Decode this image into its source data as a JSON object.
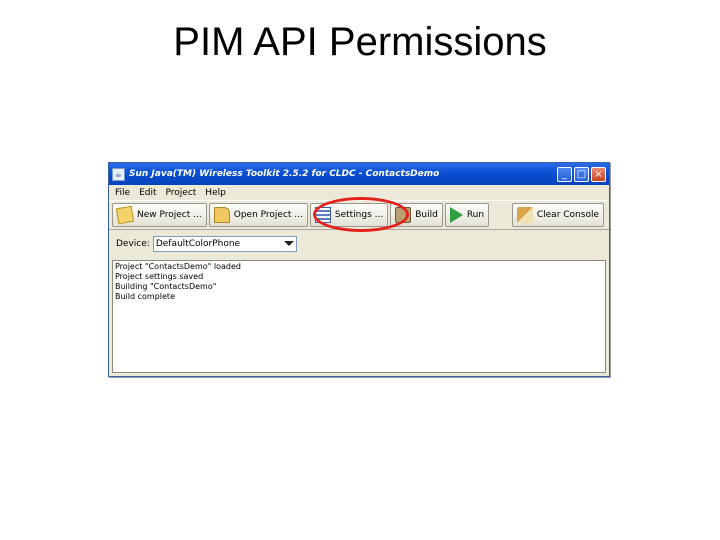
{
  "slide": {
    "title": "PIM API Permissions"
  },
  "window": {
    "title": "Sun Java(TM) Wireless Toolkit 2.5.2 for CLDC - ContactsDemo",
    "controls": {
      "minimize": "_",
      "maximize": "□",
      "close": "×"
    }
  },
  "menubar": {
    "items": [
      "File",
      "Edit",
      "Project",
      "Help"
    ]
  },
  "toolbar": {
    "new_project": "New Project ...",
    "open_project": "Open Project ...",
    "settings": "Settings ...",
    "build": "Build",
    "run": "Run",
    "clear_console": "Clear Console"
  },
  "device": {
    "label": "Device:",
    "selected": "DefaultColorPhone"
  },
  "console": {
    "lines": [
      "Project \"ContactsDemo\" loaded",
      "Project settings saved",
      "Building \"ContactsDemo\"",
      "Build complete"
    ]
  },
  "annotation": {
    "color": "#e3221b",
    "target": "settings"
  },
  "colors": {
    "titlebar": "#0a4fd4",
    "window_bg": "#ece9d8"
  }
}
